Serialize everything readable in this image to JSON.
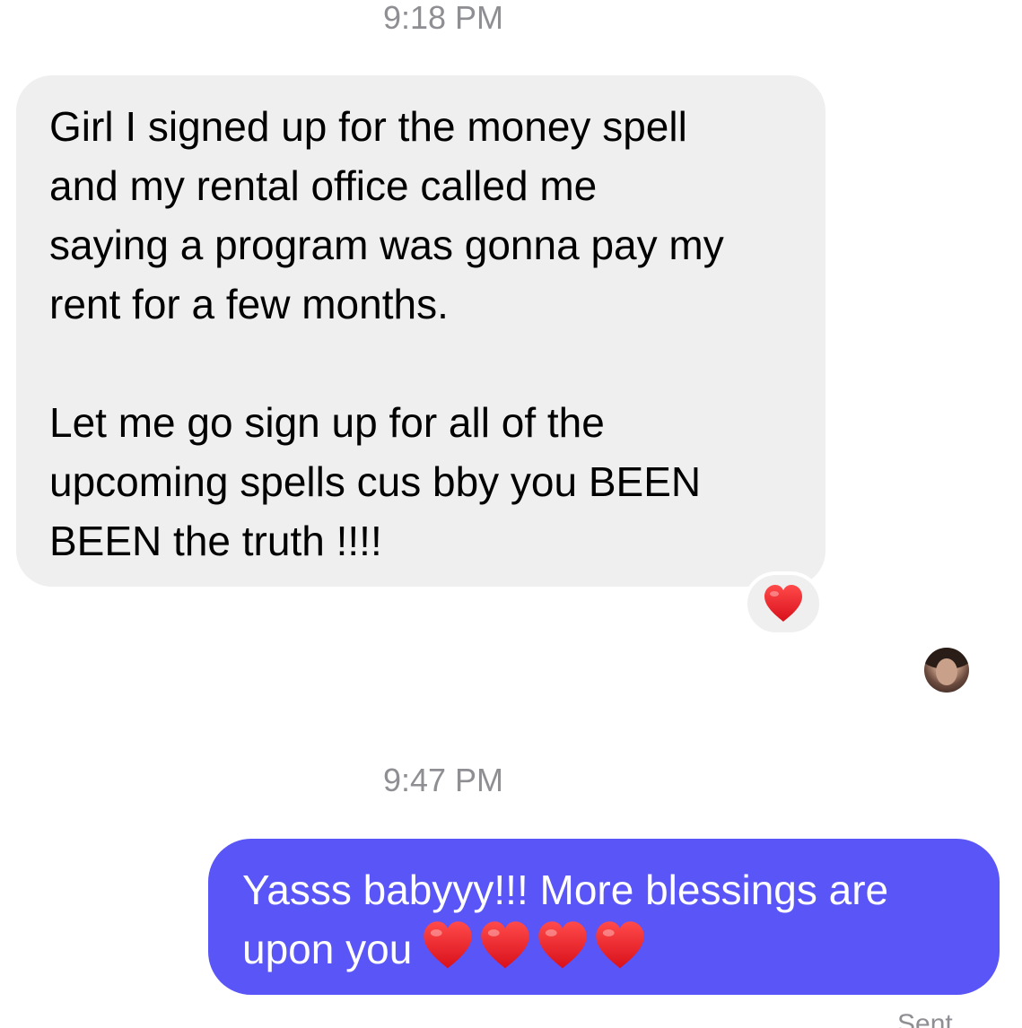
{
  "conversation": {
    "timestamp_1": "9:18 PM",
    "incoming_message": {
      "paragraph_1": "Girl I signed up for the money spell\nand my rental office called me\nsaying a program was gonna pay my\nrent for a few months.",
      "paragraph_2": "Let me go sign up for all of the\nupcoming spells cus bby you BEEN\nBEEN the truth !!!!",
      "reaction": "heart-icon",
      "bubble_color": "#efefef"
    },
    "timestamp_2": "9:47 PM",
    "outgoing_message": {
      "text_line_1": "Yasss babyyy!!! More blessings are",
      "text_line_2": "upon you",
      "emoji": [
        "heart-icon",
        "heart-icon",
        "heart-icon",
        "heart-icon"
      ],
      "bubble_color": "#5a55f6"
    },
    "status": "Sent"
  }
}
